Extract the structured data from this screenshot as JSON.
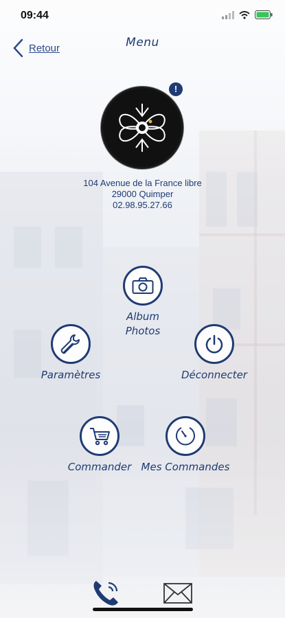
{
  "status": {
    "time": "09:44"
  },
  "header": {
    "back_label": "Retour",
    "title": "Menu"
  },
  "alert_badge": "!",
  "address": {
    "street": "104 Avenue de la France libre",
    "city": "29000 Quimper",
    "phone": "02.98.95.27.66"
  },
  "menu": {
    "album": "Album\nPhotos",
    "settings": "Paramètres",
    "logout": "Déconnecter",
    "order": "Commander",
    "my_orders": "Mes Commandes"
  },
  "colors": {
    "accent": "#1f3b73",
    "battery": "#34c759"
  },
  "icons": [
    "chevron-left-icon",
    "camera-icon",
    "wrench-icon",
    "power-icon",
    "cart-icon",
    "clock-icon",
    "phone-icon",
    "mail-icon"
  ]
}
